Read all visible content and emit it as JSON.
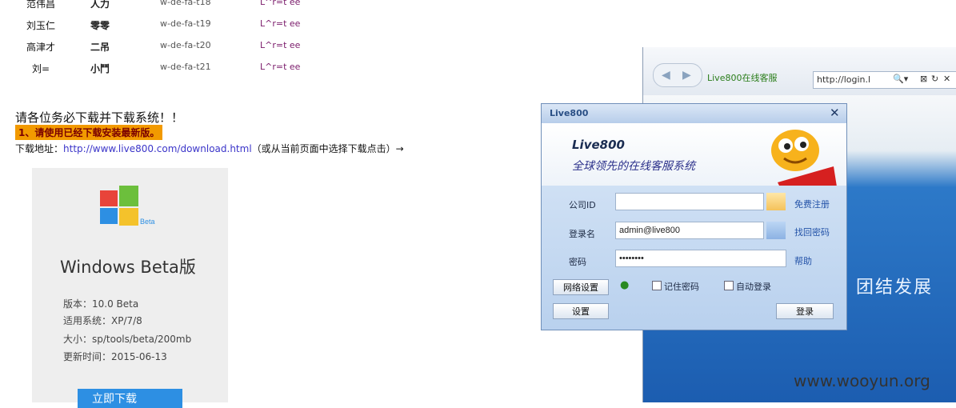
{
  "staff_rows": [
    {
      "name": "范伟昌",
      "code": "人力",
      "id": "w-de-fa-t18",
      "pw": "L^r=t ee"
    },
    {
      "name": "刘玉仁",
      "code": "零零",
      "id": "w-de-fa-t19",
      "pw": "L^r=t ee"
    },
    {
      "name": "高津才",
      "code": "二吊",
      "id": "w-de-fa-t20",
      "pw": "L^r=t ee"
    },
    {
      "name": "刘=",
      "code": "小鬥",
      "id": "w-de-fa-t21",
      "pw": "L^r=t ee"
    }
  ],
  "notice": "请各位务必下载并下载系统！！",
  "highlight": "1、请使用已经下载安装最新版。",
  "download": {
    "label": "下载地址：",
    "url": "http://www.live800.com/download.html",
    "suffix": "（或从当前页面中选择下载点击）→"
  },
  "card": {
    "title": "Windows Beta版",
    "info": [
      "版本：10.0 Beta",
      "适用系统：XP/7/8",
      "大小：sp/tools/beta/200mb",
      "更新时间：2015-06-13"
    ],
    "button_label": "立即下载"
  },
  "browser": {
    "address": "http://login.l",
    "fav_label": "Live800在线客服",
    "controls": [
      "🔍▾",
      "⊠",
      "↻",
      "✕"
    ]
  },
  "dialog": {
    "title": "Live800",
    "brand": "Live800",
    "tagline": "全球领先的在线客服系统",
    "fields": [
      {
        "label": "公司ID",
        "value": "",
        "link": "免费注册"
      },
      {
        "label": "登录名",
        "value": "admin@live800",
        "link": "找回密码"
      },
      {
        "label": "密码",
        "value": "••••••••",
        "link": "帮助"
      }
    ],
    "lang_button": "网络设置",
    "remember_label": "记住密码",
    "auto_label": "自动登录",
    "settings_button": "设置",
    "login_button": "登录"
  },
  "page_slogan": "团结发展",
  "watermark": "www.wooyun.org",
  "colors": {
    "highlight": "#f29a00",
    "link": "#3b35c9",
    "download_button": "#2d8fe3"
  }
}
